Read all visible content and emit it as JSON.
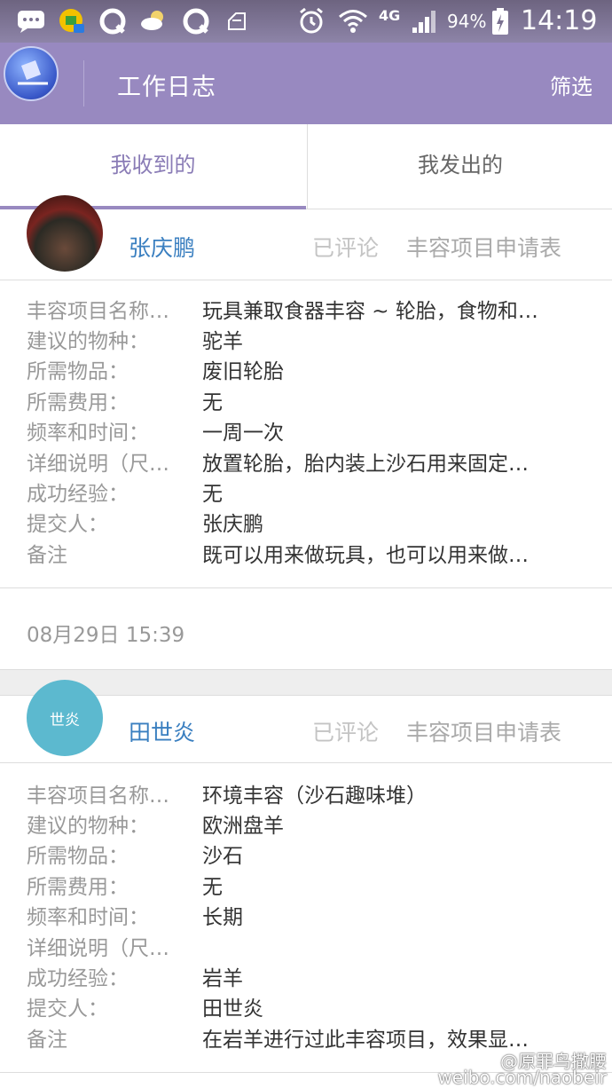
{
  "status_bar": {
    "battery": "94%",
    "network": "4G",
    "time": "14:19",
    "icons": [
      "message-icon",
      "app-icon",
      "qq-icon",
      "weather-icon",
      "qq-icon",
      "notification-icon",
      "alarm-icon",
      "wifi-icon",
      "signal-icon",
      "battery-icon"
    ]
  },
  "app_bar": {
    "title": "工作日志",
    "filter": "筛选",
    "accent": "#9889c0"
  },
  "tabs": [
    {
      "label": "我收到的",
      "active": true
    },
    {
      "label": "我发出的",
      "active": false
    }
  ],
  "entries": [
    {
      "user": "张庆鹏",
      "status": "已评论",
      "form_type": "丰容项目申请表",
      "fields": [
        {
          "label": "丰容项目名称…",
          "value": "玩具兼取食器丰容 ~ 轮胎，食物和…"
        },
        {
          "label": "建议的物种：",
          "value": "驼羊"
        },
        {
          "label": "所需物品：",
          "value": "废旧轮胎"
        },
        {
          "label": "所需费用：",
          "value": "无"
        },
        {
          "label": "频率和时间：",
          "value": "一周一次"
        },
        {
          "label": "详细说明（尺…",
          "value": "放置轮胎，胎内装上沙石用来固定…"
        },
        {
          "label": "成功经验：",
          "value": "无"
        },
        {
          "label": "提交人：",
          "value": "张庆鹏"
        },
        {
          "label": "备注",
          "value": "既可以用来做玩具，也可以用来做…"
        }
      ],
      "timestamp": "08月29日 15:39"
    },
    {
      "user": "田世炎",
      "avatar_text": "世炎",
      "status": "已评论",
      "form_type": "丰容项目申请表",
      "fields": [
        {
          "label": "丰容项目名称…",
          "value": "环境丰容（沙石趣味堆）"
        },
        {
          "label": "建议的物种：",
          "value": "欧洲盘羊"
        },
        {
          "label": "所需物品：",
          "value": "沙石"
        },
        {
          "label": "所需费用：",
          "value": "无"
        },
        {
          "label": "频率和时间：",
          "value": "长期"
        },
        {
          "label": "详细说明（尺…",
          "value": ""
        },
        {
          "label": "成功经验：",
          "value": "岩羊"
        },
        {
          "label": "提交人：",
          "value": "田世炎"
        },
        {
          "label": "备注",
          "value": "在岩羊进行过此丰容项目，效果显…"
        }
      ]
    }
  ],
  "watermark": {
    "line1": "@原罪鸟撒腰",
    "line2": "weibo.com/naobeir"
  }
}
